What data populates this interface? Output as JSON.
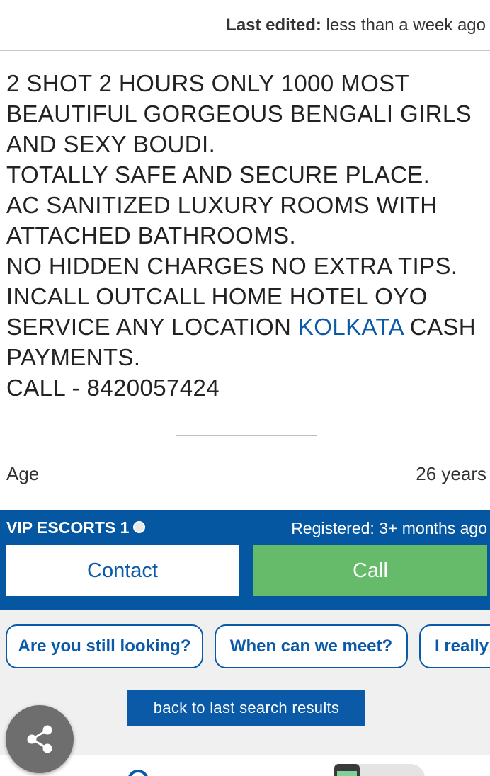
{
  "header": {
    "last_edited_label": "Last edited:",
    "last_edited_value": "less than a week ago"
  },
  "description": {
    "lines": [
      "2 SHOT 2 HOURS ONLY 1000 MOST",
      "BEAUTIFUL GORGEOUS BENGALI GIRLS",
      "AND SEXY BOUDI.",
      "TOTALLY SAFE AND SECURE PLACE.",
      "AC SANITIZED LUXURY ROOMS WITH",
      "ATTACHED BATHROOMS.",
      "NO HIDDEN CHARGES NO EXTRA TIPS.",
      "INCALL OUTCALL HOME HOTEL OYO"
    ],
    "line9_before": "SERVICE ANY LOCATION ",
    "line9_link": "KOLKATA",
    "line9_after": " CASH",
    "line10": "PAYMENTS.",
    "line11": "CALL - 8420057424"
  },
  "details": {
    "age_label": "Age",
    "age_value": "26 years"
  },
  "contact": {
    "poster_name": "VIP ESCORTS 1",
    "registered": "Registered: 3+ months ago",
    "contact_label": "Contact",
    "call_label": "Call"
  },
  "quick_replies": [
    "Are you still looking?",
    "When can we meet?",
    "I really"
  ],
  "back_button": "back to last search results",
  "colors": {
    "brand_blue": "#0457a0",
    "link_blue": "#0a5aa8",
    "call_green": "#66bb6a",
    "share_grey": "#6e6e6e"
  },
  "icons": {
    "share": "share-icon",
    "status": "online-status-dot"
  }
}
